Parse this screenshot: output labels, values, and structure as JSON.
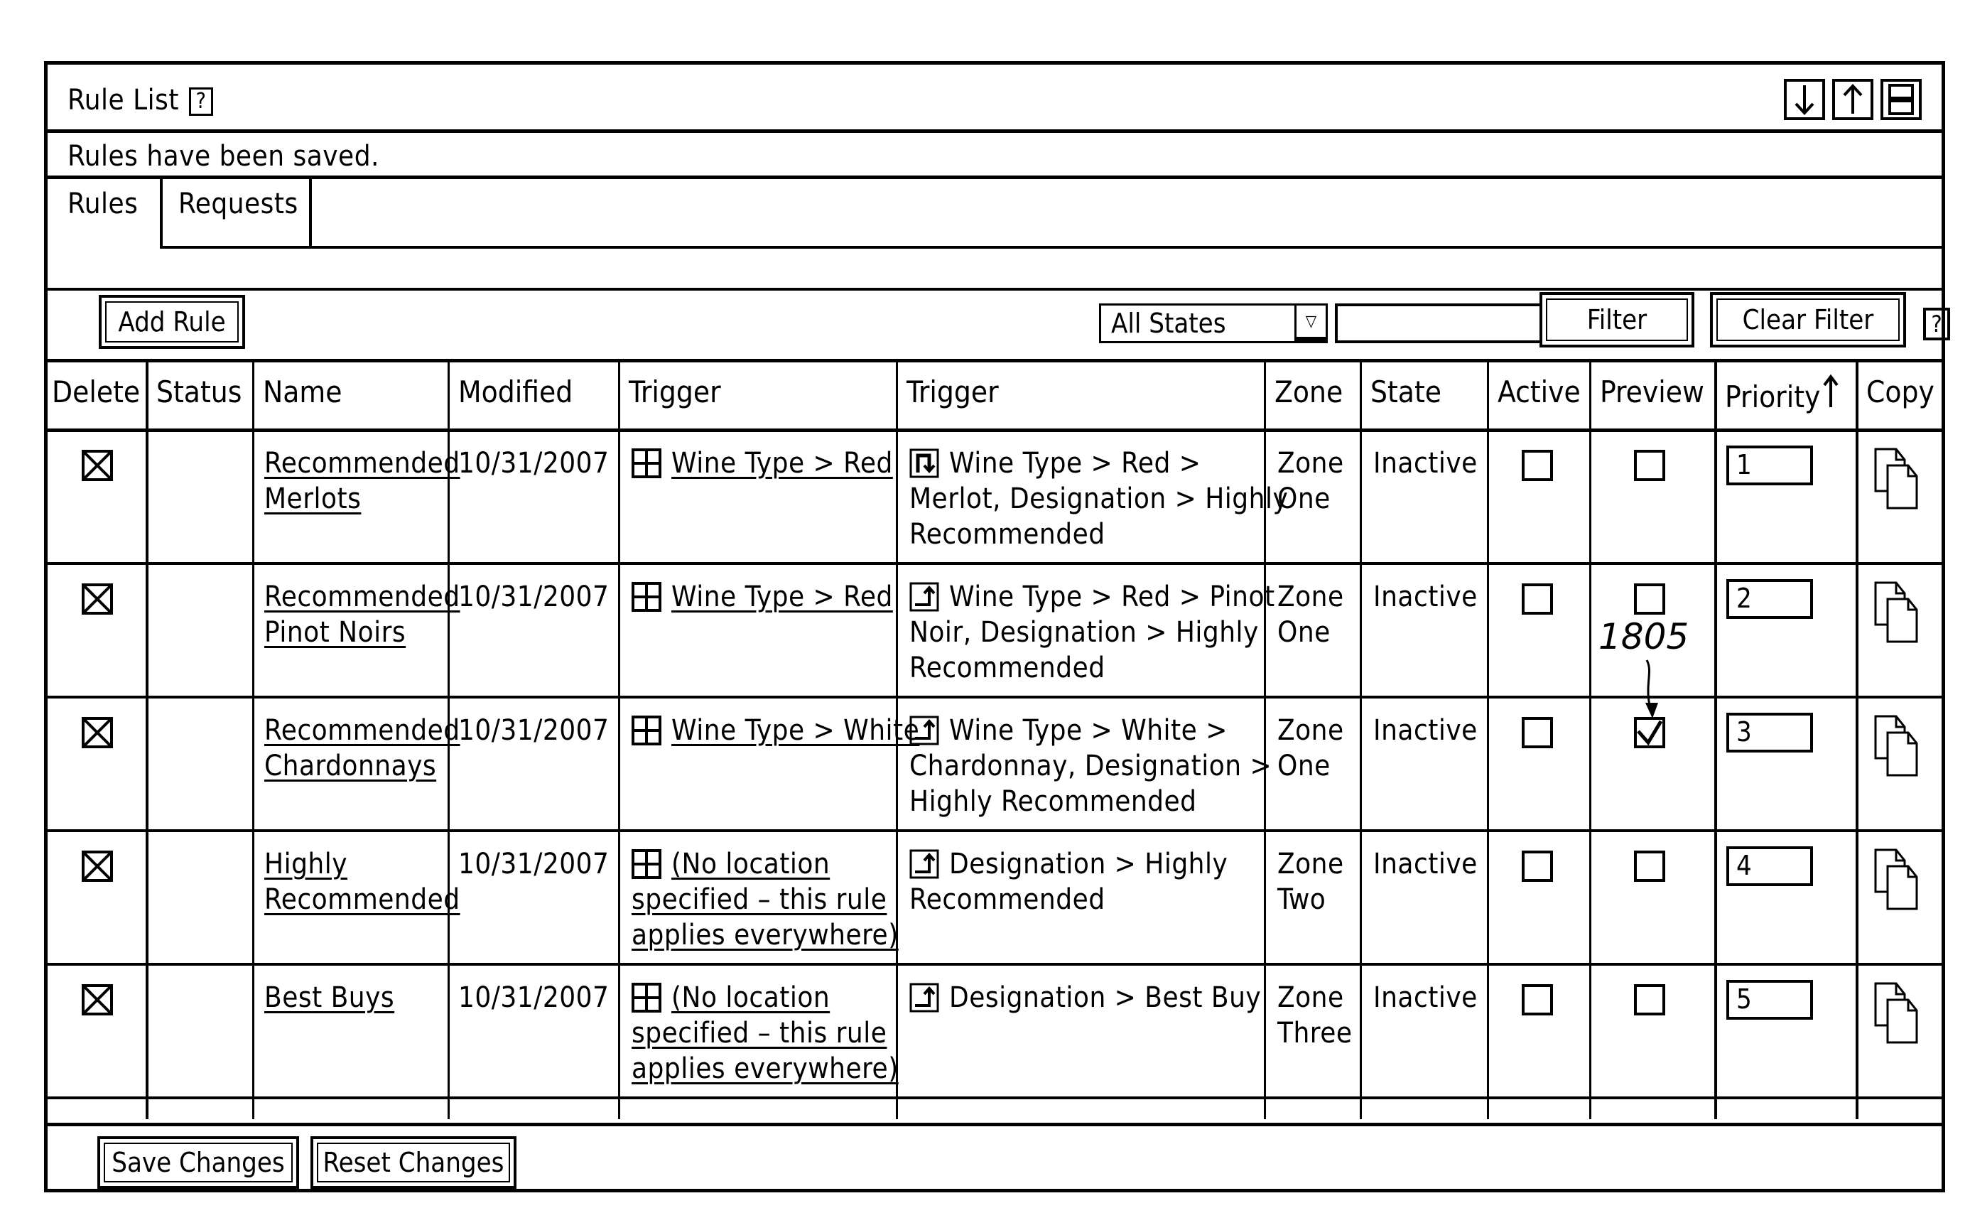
{
  "window": {
    "title": "Rule List",
    "help_label": "?",
    "controls": [
      {
        "name": "move-down",
        "icon": "arrow-down-icon"
      },
      {
        "name": "move-up",
        "icon": "arrow-up-icon"
      },
      {
        "name": "toggle-panel",
        "icon": "panel-icon"
      }
    ]
  },
  "status_message": "Rules have been saved.",
  "tabs": [
    {
      "label": "Rules",
      "active": true
    },
    {
      "label": "Requests",
      "active": false
    }
  ],
  "toolbar": {
    "add_rule_label": "Add Rule",
    "state_filter": {
      "selected": "All States"
    },
    "filter_text": {
      "value": "",
      "placeholder": ""
    },
    "filter_label": "Filter",
    "clear_filter_label": "Clear Filter",
    "help_label": "?"
  },
  "table": {
    "columns": [
      "Delete",
      "Status",
      "Name",
      "Modified",
      "Trigger",
      "Trigger",
      "Zone",
      "State",
      "Active",
      "Preview",
      "Priority",
      "Copy"
    ],
    "sort": {
      "column": "Priority",
      "direction": "ascending"
    },
    "rows": [
      {
        "delete": true,
        "status": "",
        "name_lines": [
          "Recommended",
          "Merlots"
        ],
        "modified": "10/31/2007",
        "location_icon": "location-grid-icon",
        "location_lines": [
          "Wine Type > Red"
        ],
        "trigger_icon": "drill-down-icon",
        "trigger_lines": [
          "Wine Type > Red >",
          "Merlot, Designation > Highly",
          "Recommended"
        ],
        "zone_lines": [
          "Zone",
          "One"
        ],
        "state": "Inactive",
        "active": false,
        "preview": false,
        "priority": "1"
      },
      {
        "delete": true,
        "status": "",
        "name_lines": [
          "Recommended",
          "Pinot Noirs"
        ],
        "modified": "10/31/2007",
        "location_icon": "location-grid-icon",
        "location_lines": [
          "Wine Type > Red"
        ],
        "trigger_icon": "drill-up-icon",
        "trigger_lines": [
          "Wine Type > Red > Pinot",
          "Noir, Designation > Highly",
          "Recommended"
        ],
        "zone_lines": [
          "Zone",
          "One"
        ],
        "state": "Inactive",
        "active": false,
        "preview": false,
        "priority": "2"
      },
      {
        "delete": true,
        "status": "",
        "name_lines": [
          "Recommended",
          "Chardonnays"
        ],
        "modified": "10/31/2007",
        "location_icon": "location-grid-icon",
        "location_lines": [
          "Wine Type > White"
        ],
        "trigger_icon": "drill-up-icon",
        "trigger_lines": [
          "Wine Type > White >",
          "Chardonnay, Designation >",
          "Highly Recommended"
        ],
        "zone_lines": [
          "Zone",
          "One"
        ],
        "state": "Inactive",
        "active": false,
        "preview": true,
        "priority": "3"
      },
      {
        "delete": true,
        "status": "",
        "name_lines": [
          "Highly",
          "Recommended"
        ],
        "modified": "10/31/2007",
        "location_icon": "location-grid-icon",
        "location_lines": [
          "(No location",
          "specified – this rule",
          "applies everywhere)"
        ],
        "trigger_icon": "drill-up-icon",
        "trigger_lines": [
          "Designation > Highly",
          "Recommended"
        ],
        "zone_lines": [
          "Zone",
          "Two"
        ],
        "state": "Inactive",
        "active": false,
        "preview": false,
        "priority": "4"
      },
      {
        "delete": true,
        "status": "",
        "name_lines": [
          "Best Buys"
        ],
        "modified": "10/31/2007",
        "location_icon": "location-grid-icon",
        "location_lines": [
          "(No location",
          "specified – this rule",
          "applies everywhere)"
        ],
        "trigger_icon": "drill-up-icon",
        "trigger_lines": [
          "Designation > Best Buy"
        ],
        "zone_lines": [
          "Zone",
          "Three"
        ],
        "state": "Inactive",
        "active": false,
        "preview": false,
        "priority": "5"
      }
    ]
  },
  "annotation": {
    "label": "1805"
  },
  "footer": {
    "save_label": "Save Changes",
    "reset_label": "Reset Changes"
  }
}
